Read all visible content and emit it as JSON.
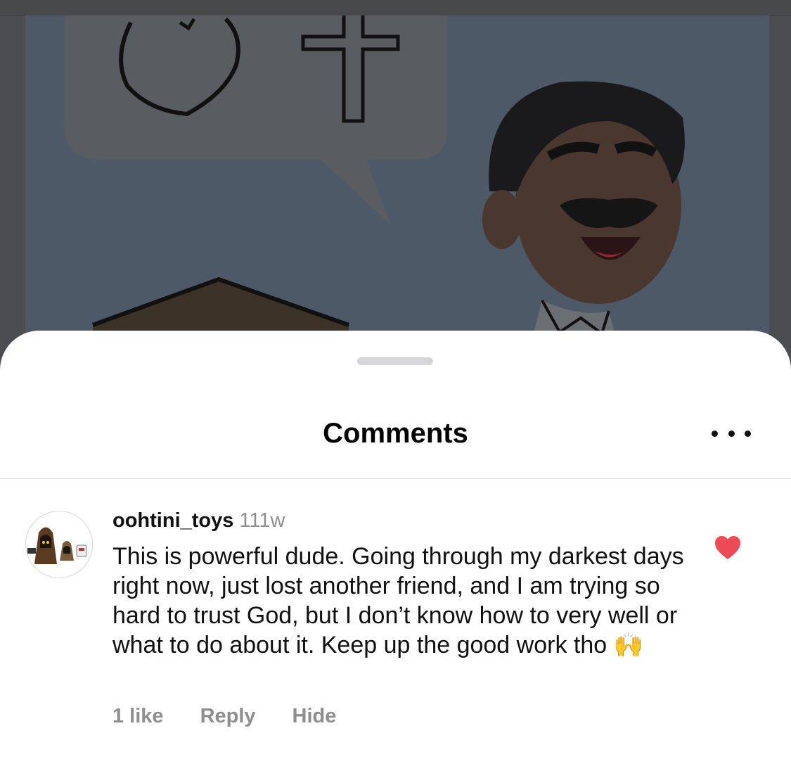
{
  "sheet": {
    "title": "Comments"
  },
  "comment": {
    "username": "oohtini_toys",
    "time": "111w",
    "text": "This is powerful dude. Going through my darkest days right now, just lost another friend, and I am trying so hard to trust God, but I don’t know how to very well or what to do about it. Keep up the good work tho 🙌",
    "liked": true,
    "likes_label": "1 like",
    "reply_label": "Reply",
    "hide_label": "Hide"
  },
  "colors": {
    "like_heart": "#ed4956",
    "muted_text": "#8e8e8e",
    "backdrop": "#4b4d50"
  }
}
